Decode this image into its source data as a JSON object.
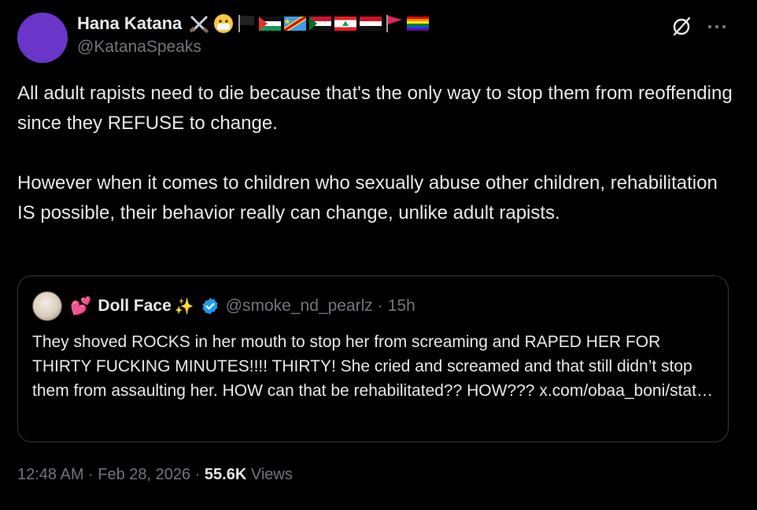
{
  "author": {
    "display_name": "Hana Katana",
    "handle": "@KatanaSpeaks",
    "avatar_color": "#6a35c9",
    "emoji": [
      "crossed-swords-icon",
      "face-with-mask-icon",
      "black-flag-icon",
      "palestine-flag-icon",
      "drc-flag-icon",
      "sudan-flag-icon",
      "lebanon-flag-icon",
      "yemen-flag-icon",
      "red-flag-icon",
      "rainbow-flag-icon"
    ]
  },
  "tweet": {
    "paragraph_1": "All adult rapists need to die because that's the only way to stop them from reoffending since they REFUSE to change.",
    "paragraph_2": "However when it comes to children who sexually abuse other children, rehabilitation IS possible, their behavior really can change, unlike adult rapists."
  },
  "quote": {
    "display_name": "Doll Face",
    "handle": "@smoke_nd_pearlz",
    "separator": "·",
    "time": "15h",
    "text": "They shoved ROCKS in her mouth to stop her from screaming and RAPED HER FOR THIRTY FUCKING MINUTES!!!! THIRTY! She cried and screamed and that still didn’t stop them from assaulting her. HOW can that be rehabilitated?? HOW??? x.com/obaa_boni/stat…",
    "verified_color": "#1d9bf0"
  },
  "meta": {
    "timestamp": "12:48 AM · Feb 28, 2026 · ",
    "views_count": "55.6K",
    "views_label": " Views"
  },
  "colors": {
    "background": "#000000",
    "text_primary": "#e7e9ea",
    "text_secondary": "#71767b",
    "border": "#333639"
  }
}
